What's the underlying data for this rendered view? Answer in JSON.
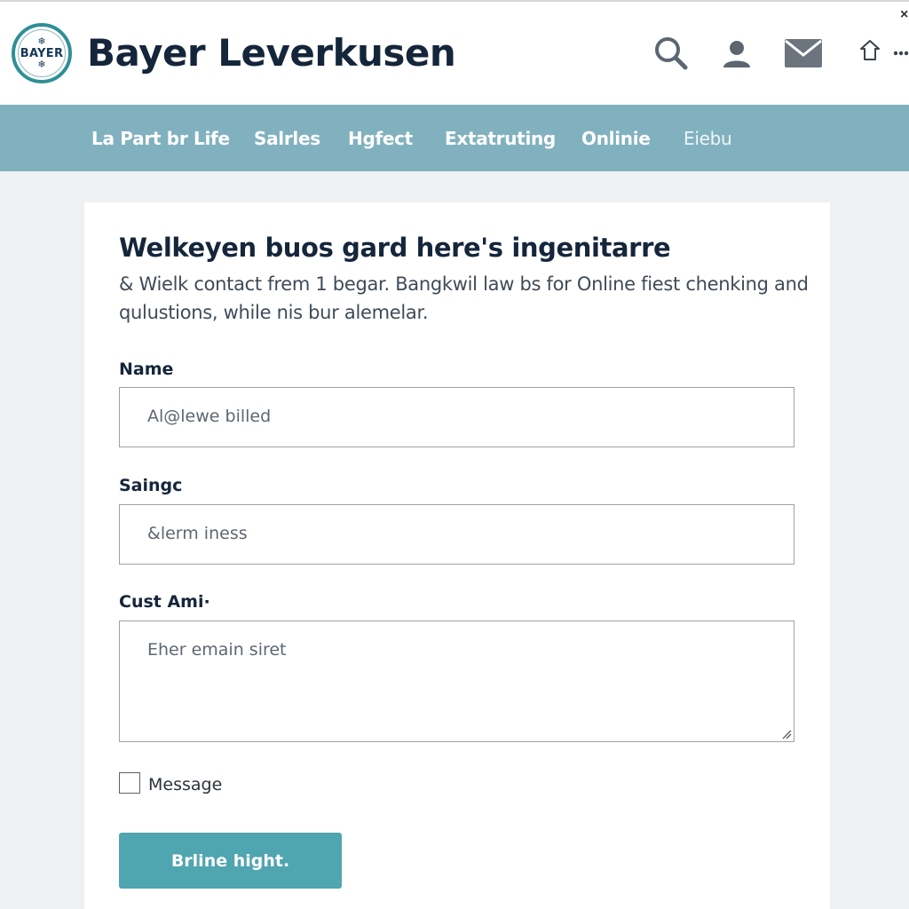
{
  "header": {
    "logo_text": "BAYER",
    "brand": "Bayer Leverkusen",
    "icons": [
      "search-icon",
      "user-icon",
      "mail-icon",
      "star-icon",
      "more-icon"
    ],
    "close_glyph": "×"
  },
  "nav": {
    "items": [
      {
        "label": "La Part br Life"
      },
      {
        "label": "Salrles"
      },
      {
        "label": "Hgfect"
      },
      {
        "label": "Extatruting"
      },
      {
        "label": "Onlinie"
      },
      {
        "label": "Eiebu"
      }
    ]
  },
  "form": {
    "heading": "Welkeyen buos gard here's ingenitarre",
    "intro_line1": "& Wielk contact frem 1 begar. Bangkwil law bs for Online fiest chenking and",
    "intro_line2": "qulustions, while nis bur alemelar.",
    "fields": [
      {
        "label": "Name",
        "placeholder": "Al@lewe billed"
      },
      {
        "label": "Saingc",
        "placeholder": "&lerm iness"
      },
      {
        "label": "Cust Ami·",
        "placeholder": "Eher emain siret"
      }
    ],
    "checkbox_label": "Message",
    "checkbox_checked": false,
    "submit_label": "Brline hight."
  },
  "colors": {
    "nav_bg": "#81b1bf",
    "button_bg": "#4fa5b0",
    "logo_ring": "#2f8f97",
    "brand_text": "#15263b"
  }
}
